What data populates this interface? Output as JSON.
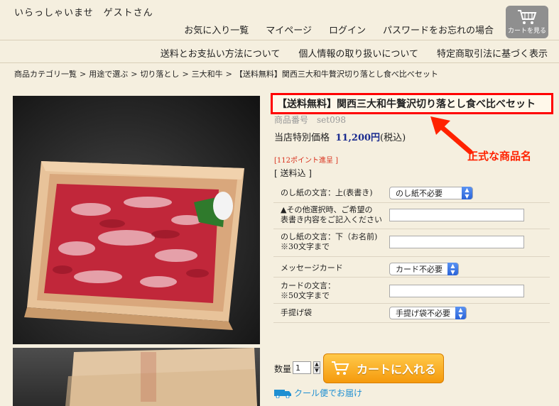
{
  "header": {
    "greeting": "いらっしゃいませ　ゲストさん",
    "nav_primary": [
      "お気に入り一覧",
      "マイページ",
      "ログイン",
      "パスワードをお忘れの場合"
    ],
    "nav_secondary": [
      "送料とお支払い方法について",
      "個人情報の取り扱いについて",
      "特定商取引法に基づく表示"
    ],
    "cart_button_label": "カートを見る"
  },
  "breadcrumb": [
    "商品カテゴリ一覧",
    "用途で選ぶ",
    "切り落とし",
    "三大和牛",
    "【送料無料】関西三大和牛贅沢切り落とし食べ比べセット"
  ],
  "breadcrumb_separator": ">",
  "product": {
    "title": "【送料無料】関西三大和牛贅沢切り落とし食べ比べセット",
    "code_label": "商品番号　set098",
    "price_label": "当店特別価格",
    "price_value": "11,200円",
    "price_tax": "(税込)",
    "points": "[112ポイント進呈 ]",
    "shipping": "[ 送料込 ]"
  },
  "annotation": {
    "label": "正式な商品名",
    "color": "#ff2200"
  },
  "options": [
    {
      "label_lines": [
        "のし紙の文言：上(表書き)"
      ],
      "type": "select",
      "value": "のし紙不必要"
    },
    {
      "label_lines": [
        "▲その他選択時、ご希望の",
        "表書き内容をご記入ください"
      ],
      "type": "text",
      "value": ""
    },
    {
      "label_lines": [
        "のし紙の文言：下（お名前)",
        "※30文字まで"
      ],
      "type": "text",
      "value": ""
    },
    {
      "label_lines": [
        "メッセージカード"
      ],
      "type": "select",
      "value": "カード不必要"
    },
    {
      "label_lines": [
        "カードの文言：",
        "※50文字まで"
      ],
      "type": "text",
      "value": ""
    },
    {
      "label_lines": [
        "手提げ袋"
      ],
      "type": "select",
      "value": "手提げ袋不必要"
    }
  ],
  "purchase": {
    "qty_label": "数量",
    "qty_value": "1",
    "add_to_cart_label": "カートに入れる",
    "cool_delivery": "クール便でお届け"
  },
  "colors": {
    "background": "#f5efdf",
    "highlight_border": "#ff0000",
    "price": "#1a2b8f",
    "points": "#d9301c",
    "cart_button": "#f59a0c"
  }
}
